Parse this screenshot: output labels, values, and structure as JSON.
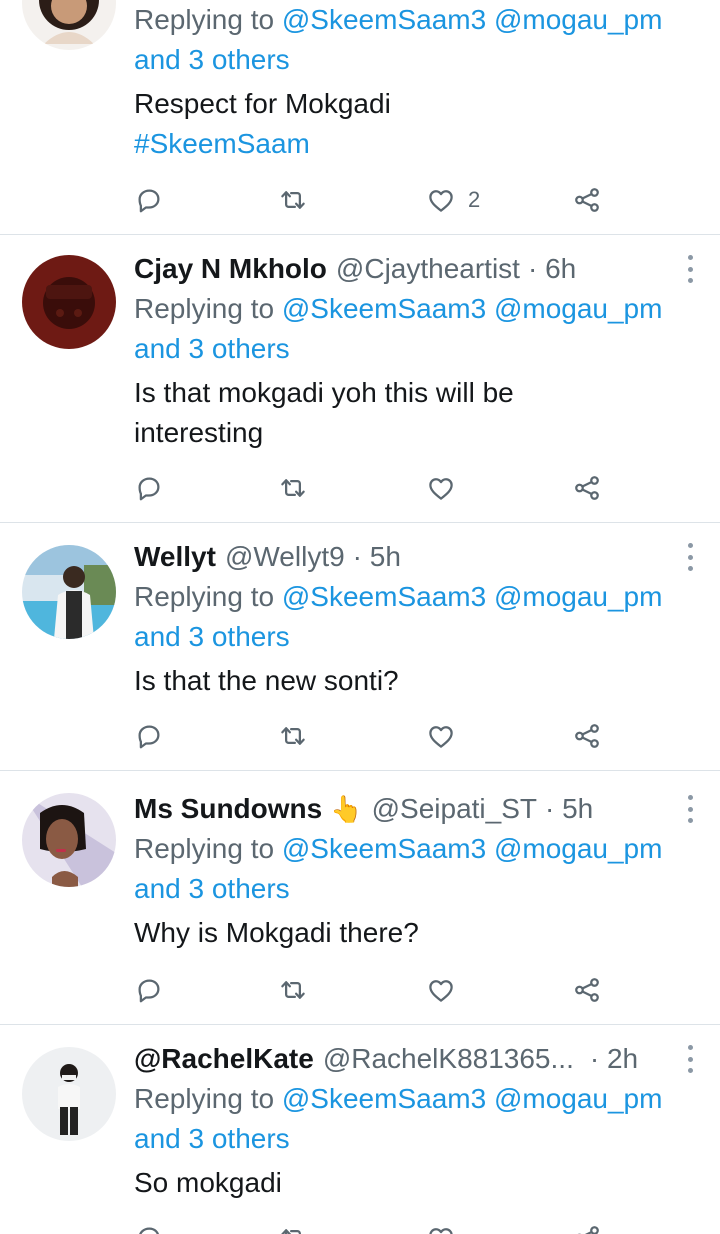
{
  "tweets": [
    {
      "reply_prefix": "Replying to",
      "reply_to": "@SkeemSaam3 @mogau_pm and 3 others",
      "text": "Respect for Mokgadi",
      "hashtag": "#SkeemSaam",
      "like_count": "2"
    },
    {
      "name": "Cjay N Mkholo",
      "handle": "@Cjaytheartist",
      "time": "· 6h",
      "reply_prefix": "Replying to",
      "reply_to": "@SkeemSaam3 @mogau_pm and 3 others",
      "text": "Is that mokgadi yoh this will be interesting"
    },
    {
      "name": "Wellyt",
      "handle": "@Wellyt9",
      "time": "· 5h",
      "reply_prefix": "Replying to",
      "reply_to": "@SkeemSaam3 @mogau_pm and 3 others",
      "text": "Is that the new sonti?"
    },
    {
      "name": "Ms Sundowns",
      "emoji": "👆",
      "handle": "@Seipati_ST",
      "time": "· 5h",
      "reply_prefix": "Replying to",
      "reply_to": "@SkeemSaam3 @mogau_pm and 3 others",
      "text": "Why is Mokgadi there?"
    },
    {
      "name": "@RachelKate",
      "handle": "@RachelK881365...",
      "time": "· 2h",
      "reply_prefix": "Replying to",
      "reply_to": "@SkeemSaam3 @mogau_pm and 3 others",
      "text": "So mokgadi"
    }
  ],
  "icons": {
    "reply": "reply-icon",
    "retweet": "retweet-icon",
    "like": "heart-icon",
    "share": "share-icon",
    "more": "more-options-icon"
  },
  "colors": {
    "link": "#1b95e0",
    "secondary_text": "#5b6770",
    "divider": "#dde3e8"
  }
}
